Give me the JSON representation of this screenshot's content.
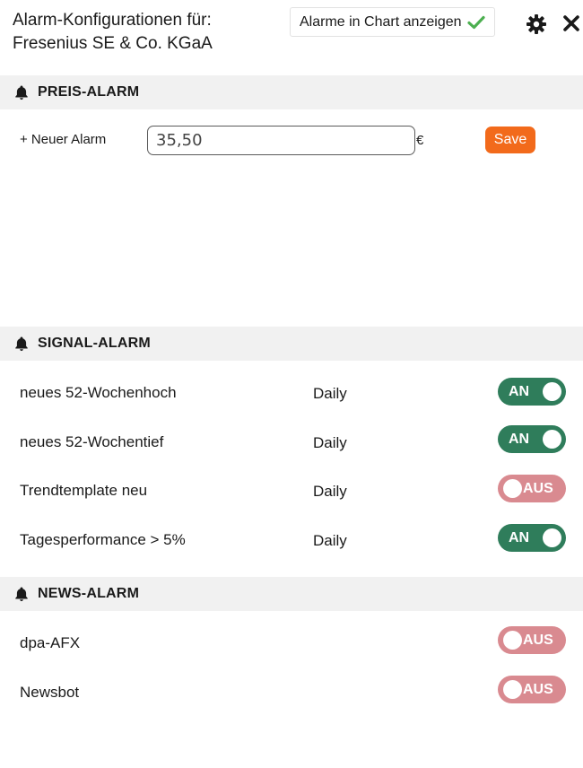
{
  "header": {
    "title_line1": "Alarm-Konfigurationen für:",
    "title_line2": "Fresenius SE & Co. KGaA",
    "chart_toggle_label": "Alarme in Chart anzeigen",
    "icons": {
      "settings": "gear-icon",
      "close": "close-icon",
      "check": "checkmark-icon"
    }
  },
  "price_alarm": {
    "section_title": "PREIS-ALARM",
    "new_alarm_label": "+ Neuer Alarm",
    "input_value": "35,50",
    "currency": "€",
    "save_label": "Save"
  },
  "signal_alarm": {
    "section_title": "SIGNAL-ALARM",
    "rows": [
      {
        "label": "neues 52-Wochenhoch",
        "frequency": "Daily",
        "state": "AN"
      },
      {
        "label": "neues 52-Wochentief",
        "frequency": "Daily",
        "state": "AN"
      },
      {
        "label": "Trendtemplate neu",
        "frequency": "Daily",
        "state": "AUS"
      },
      {
        "label": "Tagesperformance > 5%",
        "frequency": "Daily",
        "state": "AN"
      }
    ]
  },
  "news_alarm": {
    "section_title": "NEWS-ALARM",
    "rows": [
      {
        "label": "dpa-AFX",
        "state": "AUS"
      },
      {
        "label": "Newsbot",
        "state": "AUS"
      }
    ]
  },
  "colors": {
    "toggle_on": "#2f7d5b",
    "toggle_off": "#d98a90",
    "save_button": "#f26a1b",
    "section_bar": "#f1f1f1",
    "check": "#4caf50"
  }
}
